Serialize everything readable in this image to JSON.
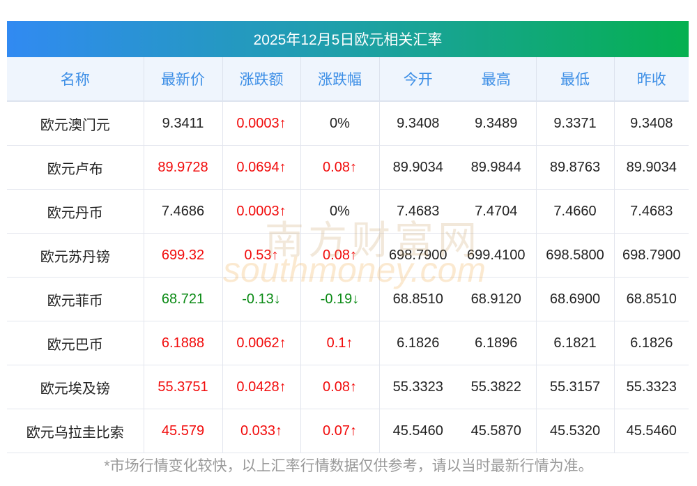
{
  "title": "2025年12月5日欧元相关汇率",
  "columns": [
    "名称",
    "最新价",
    "涨跌额",
    "涨跌幅",
    "今开",
    "最高",
    "最低",
    "昨收"
  ],
  "rows": [
    {
      "name": "欧元澳门元",
      "price": "9.3411",
      "change": "0.0003↑",
      "pct": "0%",
      "open": "9.3408",
      "high": "9.3489",
      "low": "9.3371",
      "prev": "9.3408",
      "price_dir": "flat",
      "change_dir": "up",
      "pct_dir": "flat"
    },
    {
      "name": "欧元卢布",
      "price": "89.9728",
      "change": "0.0694↑",
      "pct": "0.08↑",
      "open": "89.9034",
      "high": "89.9844",
      "low": "89.8763",
      "prev": "89.9034",
      "price_dir": "up",
      "change_dir": "up",
      "pct_dir": "up"
    },
    {
      "name": "欧元丹币",
      "price": "7.4686",
      "change": "0.0003↑",
      "pct": "0%",
      "open": "7.4683",
      "high": "7.4704",
      "low": "7.4660",
      "prev": "7.4683",
      "price_dir": "flat",
      "change_dir": "up",
      "pct_dir": "flat"
    },
    {
      "name": "欧元苏丹镑",
      "price": "699.32",
      "change": "0.53↑",
      "pct": "0.08↑",
      "open": "698.7900",
      "high": "699.4100",
      "low": "698.5800",
      "prev": "698.7900",
      "price_dir": "up",
      "change_dir": "up",
      "pct_dir": "up"
    },
    {
      "name": "欧元菲币",
      "price": "68.721",
      "change": "-0.13↓",
      "pct": "-0.19↓",
      "open": "68.8510",
      "high": "68.9120",
      "low": "68.6900",
      "prev": "68.8510",
      "price_dir": "down",
      "change_dir": "down",
      "pct_dir": "down"
    },
    {
      "name": "欧元巴币",
      "price": "6.1888",
      "change": "0.0062↑",
      "pct": "0.1↑",
      "open": "6.1826",
      "high": "6.1896",
      "low": "6.1821",
      "prev": "6.1826",
      "price_dir": "up",
      "change_dir": "up",
      "pct_dir": "up"
    },
    {
      "name": "欧元埃及镑",
      "price": "55.3751",
      "change": "0.0428↑",
      "pct": "0.08↑",
      "open": "55.3323",
      "high": "55.3822",
      "low": "55.3157",
      "prev": "55.3323",
      "price_dir": "up",
      "change_dir": "up",
      "pct_dir": "up"
    },
    {
      "name": "欧元乌拉圭比索",
      "price": "45.579",
      "change": "0.033↑",
      "pct": "0.07↑",
      "open": "45.5460",
      "high": "45.5870",
      "low": "45.5320",
      "prev": "45.5460",
      "price_dir": "up",
      "change_dir": "up",
      "pct_dir": "up"
    }
  ],
  "watermark": {
    "cn": "南方财富网",
    "en": "southmoney.com"
  },
  "footer": "*市场行情变化较快，以上汇率行情数据仅供参考，请以当时最新行情为准。",
  "colors": {
    "up": "#f10b0b",
    "down": "#0a8a14",
    "header_text": "#3c8ee6"
  }
}
